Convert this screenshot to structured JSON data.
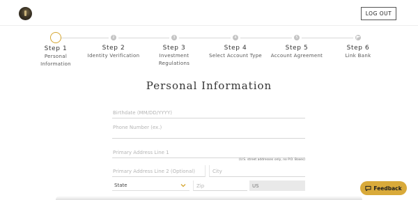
{
  "header": {
    "logout_label": "LOG OUT"
  },
  "steps": [
    {
      "title": "Step 1",
      "sub1": "Personal",
      "sub2": "Information",
      "state": "active",
      "icon": ""
    },
    {
      "title": "Step 2",
      "sub1": "Identity Verification",
      "sub2": "",
      "state": "pending",
      "icon": "2"
    },
    {
      "title": "Step 3",
      "sub1": "Investment",
      "sub2": "Regulations",
      "state": "pending",
      "icon": "3"
    },
    {
      "title": "Step 4",
      "sub1": "Select Account Type",
      "sub2": "",
      "state": "pending",
      "icon": "4"
    },
    {
      "title": "Step 5",
      "sub1": "Account Agreement",
      "sub2": "",
      "state": "pending",
      "icon": "5"
    },
    {
      "title": "Step 6",
      "sub1": "Link Bank",
      "sub2": "",
      "state": "pending",
      "icon": "flag-icon"
    }
  ],
  "form": {
    "title": "Personal Information",
    "birthdate_placeholder": "Birthdate (MM/DD/YYYY)",
    "phone_placeholder": "Phone Number (ex.)",
    "address1_placeholder": "Primary Address Line 1",
    "address_note": "(U.S. street addresses only, no P.O. Boxes)",
    "address2_placeholder": "Primary Address Line 2 (Optional)",
    "city_placeholder": "City",
    "state_value": "State",
    "zip_placeholder": "Zip",
    "country_value": "US"
  },
  "feedback_label": "Feedback",
  "colors": {
    "accent": "#d9aa3a",
    "active_ring": "#d5a630",
    "inactive_dot": "#c4c4c4"
  }
}
